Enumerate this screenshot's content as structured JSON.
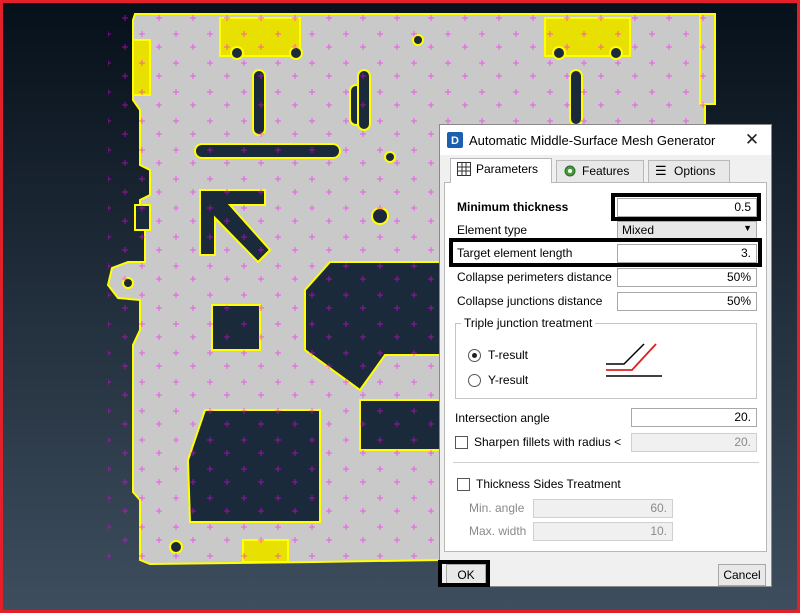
{
  "dialog": {
    "title": "Automatic Middle-Surface Mesh Generator",
    "tabs": [
      {
        "label": "Parameters",
        "icon": "grid-icon",
        "active": true
      },
      {
        "label": "Features",
        "icon": "gear-icon",
        "active": false
      },
      {
        "label": "Options",
        "icon": "menu-lines-icon",
        "active": false
      }
    ],
    "params": {
      "min_thickness_label": "Minimum thickness",
      "min_thickness_value": "0.5",
      "element_type_label": "Element type",
      "element_type_value": "Mixed",
      "target_length_label": "Target element length",
      "target_length_value": "3.",
      "collapse_perimeters_label": "Collapse perimeters distance",
      "collapse_perimeters_value": "50%",
      "collapse_junctions_label": "Collapse junctions distance",
      "collapse_junctions_value": "50%",
      "triple_junction": {
        "title": "Triple junction treatment",
        "options": [
          "T-result",
          "Y-result"
        ],
        "selected": "T-result"
      },
      "intersection_angle_label": "Intersection angle",
      "intersection_angle_value": "20.",
      "sharpen_label": "Sharpen fillets with radius <",
      "sharpen_checked": false,
      "sharpen_value": "20.",
      "thickness_sides": {
        "label": "Thickness Sides Treatment",
        "checked": false,
        "min_angle_label": "Min. angle",
        "min_angle_value": "60.",
        "max_width_label": "Max. width",
        "max_width_value": "10."
      }
    },
    "buttons": {
      "ok": "OK",
      "cancel": "Cancel"
    }
  },
  "colors": {
    "highlight_frame": "#e2202a",
    "model_fill": "#c9c9c9",
    "model_edge": "#ffff00",
    "mesh_node": "#ff00ff"
  }
}
